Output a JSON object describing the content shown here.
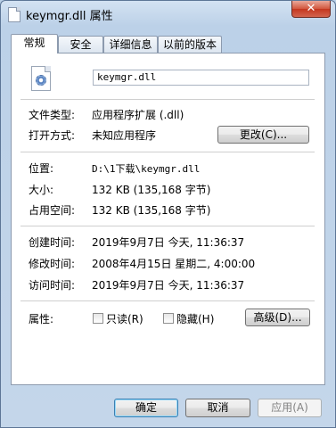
{
  "window": {
    "title": "keymgr.dll 属性",
    "close_glyph": "✕"
  },
  "tabs": [
    "常规",
    "安全",
    "详细信息",
    "以前的版本"
  ],
  "file": {
    "name": "keymgr.dll"
  },
  "rows": {
    "file_type": {
      "label": "文件类型:",
      "value": "应用程序扩展 (.dll)"
    },
    "open_with": {
      "label": "打开方式:",
      "value": "未知应用程序",
      "button": "更改(C)..."
    },
    "location": {
      "label": "位置:",
      "value": "D:\\1下载\\keymgr.dll"
    },
    "size": {
      "label": "大小:",
      "value": "132 KB (135,168 字节)"
    },
    "size_on_disk": {
      "label": "占用空间:",
      "value": "132 KB (135,168 字节)"
    },
    "created": {
      "label": "创建时间:",
      "value": "2019年9月7日 今天, 11:36:37"
    },
    "modified": {
      "label": "修改时间:",
      "value": "2008年4月15日 星期二, 4:00:00"
    },
    "accessed": {
      "label": "访问时间:",
      "value": "2019年9月7日 今天, 11:36:37"
    },
    "attributes": {
      "label": "属性:",
      "readonly": "只读(R)",
      "hidden": "隐藏(H)",
      "advanced": "高级(D)..."
    }
  },
  "footer": {
    "ok": "确定",
    "cancel": "取消",
    "apply": "应用(A)"
  }
}
